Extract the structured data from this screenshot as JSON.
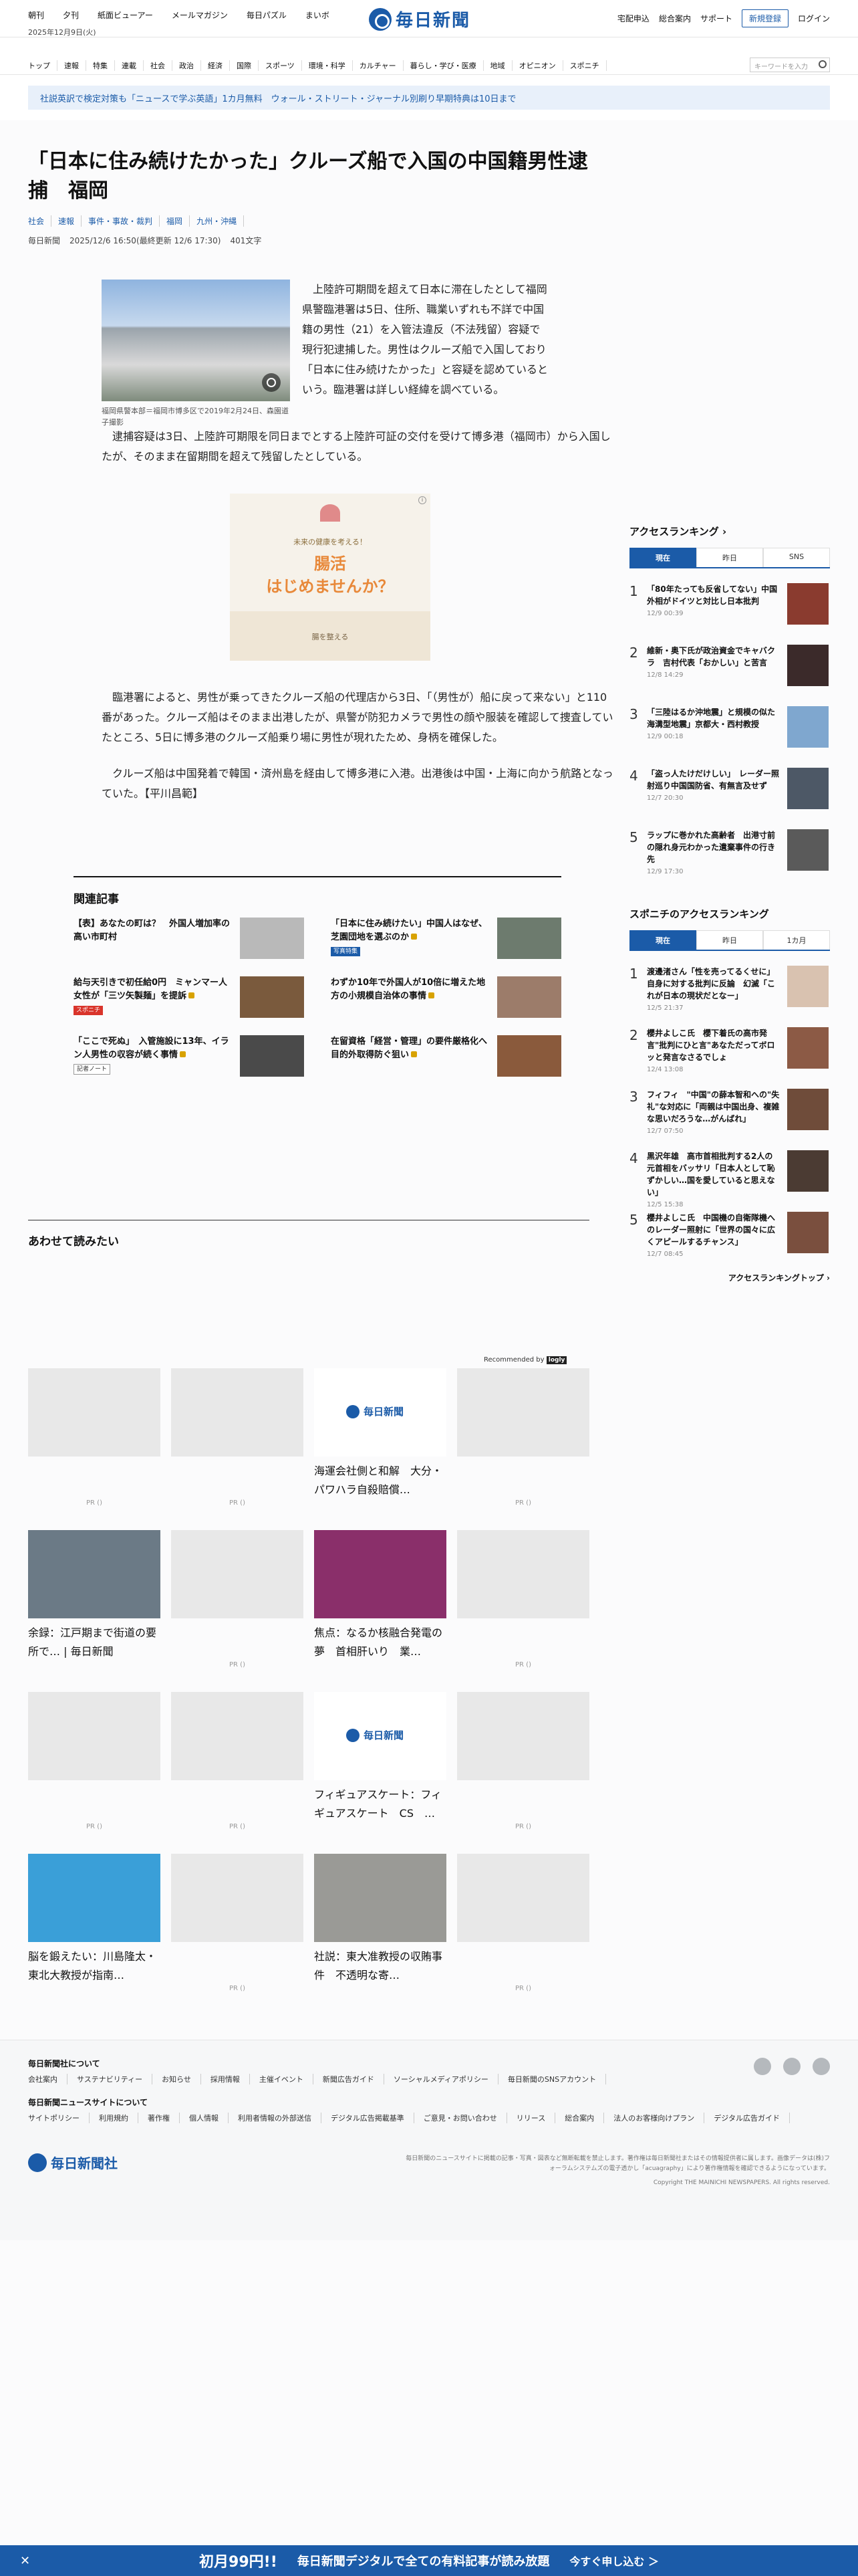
{
  "header": {
    "top_links": [
      "朝刊",
      "夕刊",
      "紙面ビューアー",
      "メールマガジン",
      "毎日パズル",
      "まいボ"
    ],
    "date": "2025年12月9日(火)",
    "logo_text": "毎日新聞",
    "right_links": [
      "宅配申込",
      "総合案内",
      "サポート"
    ],
    "register_label": "新規登録",
    "login_label": "ログイン"
  },
  "category_nav": {
    "items": [
      "トップ",
      "速報",
      "特集",
      "連載",
      "社会",
      "政治",
      "経済",
      "国際",
      "スポーツ",
      "環境・科学",
      "カルチャー",
      "暮らし・学び・医療",
      "地域",
      "オピニオン",
      "スポニチ"
    ],
    "search_placeholder": "キーワードを入力"
  },
  "promo": {
    "text": "社説英訳で検定対策も「ニュースで学ぶ英語」1カ月無料　ウォール・ストリート・ジャーナル別刷り早期特典は10日まで"
  },
  "article": {
    "title": "「日本に住み続けたかった」クルーズ船で入国の中国籍男性逮捕　福岡",
    "tags": [
      "社会",
      "速報",
      "事件・事故・裁判",
      "福岡",
      "九州・沖縄"
    ],
    "source": "毎日新聞",
    "datetime": "2025/12/6 16:50(最終更新 12/6 17:30)",
    "chars": "401文字",
    "photo_caption": "福岡県警本部＝福岡市博多区で2019年2月24日、森園道子撮影",
    "p1": "上陸許可期間を超えて日本に滞在したとして福岡県警臨港署は5日、住所、職業いずれも不詳で中国籍の男性（21）を入管法違反（不法残留）容疑で現行犯逮捕した。男性はクルーズ船で入国しており「日本に住み続けたかった」と容疑を認めているという。臨港署は詳しい経緯を調べている。",
    "p2": "逮捕容疑は3日、上陸許可期限を同日までとする上陸許可証の交付を受けて博多港（福岡市）から入国したが、そのまま在留期間を超えて残留したとしている。",
    "p3": "臨港署によると、男性が乗ってきたクルーズ船の代理店から3日、「（男性が）船に戻って来ない」と110番があった。クルーズ船はそのまま出港したが、県警が防犯カメラで男性の顔や服装を確認して捜査していたところ、5日に博多港のクルーズ船乗り場に男性が現れたため、身柄を確保した。",
    "p4": "クルーズ船は中国発着で韓国・済州島を経由して博多港に入港。出港後は中国・上海に向かう航路となっていた。【平川昌範】"
  },
  "ad": {
    "line1": "未来の健康を考える！",
    "main1": "腸活",
    "main2": "はじめませんか？",
    "foot": "腸を整える"
  },
  "related": {
    "title": "関連記事",
    "items": [
      {
        "text": "【表】あなたの町は？　外国人増加率の高い市町村",
        "badge": "",
        "locked": false,
        "color": "#b9b9b9"
      },
      {
        "text": "「日本に住み続けたい」中国人はなぜ、芝園団地を選ぶのか",
        "badge": "写真特集",
        "locked": true,
        "color": "#6d7b6e"
      },
      {
        "text": "給与天引きで初任給0円　ミャンマー人女性が「三ツ矢製麺」を提訴",
        "badge": "スポニチ",
        "locked": true,
        "color": "#7a5a3d"
      },
      {
        "text": "わずか10年で外国人が10倍に増えた地方の小規模自治体の事情",
        "badge": "",
        "locked": true,
        "color": "#9c7c6a"
      },
      {
        "text": "「ここで死ぬ」　入管施設に13年、イラン人男性の収容が続く事情",
        "badge": "記者ノート",
        "locked": true,
        "color": "#4a4a4a"
      },
      {
        "text": "在留資格「経営・管理」の要件厳格化へ　目的外取得防ぐ狙い",
        "badge": "",
        "locked": true,
        "color": "#8a5a3c"
      }
    ]
  },
  "read_more": {
    "title": "あわせて読みたい",
    "recommended_label": "Recommended by",
    "recommended_brand": "logly",
    "items": [
      {
        "title": "",
        "pr": "PR ()"
      },
      {
        "title": "",
        "pr": "PR ()"
      },
      {
        "title": "海運会社側と和解　大分・パワハラ自殺賠償…",
        "pr": ""
      },
      {
        "title": "",
        "pr": "PR ()"
      },
      {
        "title": "余録：江戸期まで街道の要所で… | 毎日新聞",
        "pr": ""
      },
      {
        "title": "",
        "pr": "PR ()"
      },
      {
        "title": "焦点：なるか核融合発電の夢　首相肝いり　業…",
        "pr": ""
      },
      {
        "title": "",
        "pr": "PR ()"
      },
      {
        "title": "",
        "pr": "PR ()"
      },
      {
        "title": "",
        "pr": "PR ()"
      },
      {
        "title": "フィギュアスケート：フィギュアスケート　CS　…",
        "pr": ""
      },
      {
        "title": "",
        "pr": "PR ()"
      },
      {
        "title": "脳を鍛えたい：川島隆太・東北大教授が指南…",
        "pr": ""
      },
      {
        "title": "",
        "pr": "PR ()"
      },
      {
        "title": "社説：東大准教授の収賄事件　不透明な寄…",
        "pr": ""
      },
      {
        "title": "",
        "pr": "PR ()"
      }
    ]
  },
  "sidebar": {
    "ranking_title": "アクセスランキング",
    "ranking_tabs": [
      "現在",
      "昨日",
      "SNS"
    ],
    "ranking": [
      {
        "num": "1",
        "text": "「80年たっても反省してない」中国外相がドイツと対比し日本批判",
        "time": "12/9 00:39",
        "color": "#8a3b2f"
      },
      {
        "num": "2",
        "text": "維新・奥下氏が政治資金でキャバクラ　吉村代表「おかしい」と苦言",
        "time": "12/8 14:29",
        "color": "#3b2a2a"
      },
      {
        "num": "3",
        "text": "「三陸はるか沖地震」と規模の似た海溝型地震」京都大・西村教授",
        "time": "12/9 00:18",
        "color": "#7fa7cf"
      },
      {
        "num": "4",
        "text": "「盗っ人たけだけしい」　レーダー照射巡り中国国防省、有無言及せず",
        "time": "12/7 20:30",
        "color": "#4d5866"
      },
      {
        "num": "5",
        "text": "ラップに巻かれた高齢者　出港寸前の隠れ身元わかった遺棄事件の行き先",
        "time": "12/9 17:30",
        "color": "#5a5a5a"
      }
    ],
    "sponichi_title": "スポニチのアクセスランキング",
    "sponichi_tabs": [
      "現在",
      "昨日",
      "1カ月"
    ],
    "sponichi": [
      {
        "num": "1",
        "text": "渡邊渚さん「性を売ってるくせに」自身に対する批判に反論　幻滅「これが日本の現状だとなー」",
        "time": "12/5 21:37",
        "color": "#d9c2b0"
      },
      {
        "num": "2",
        "text": "櫻井よしこ氏　櫻下着氏の高市発言\"批判にひと言\"あなただってボロッと発言なさるでしょ",
        "time": "12/4 13:08",
        "color": "#8c5a45"
      },
      {
        "num": "3",
        "text": "フィフィ　\"中国\"の薛本智和への\"失礼\"な対応に「両親は中国出身、複雑な思いだろうな…がんばれ」",
        "time": "12/7 07:50",
        "color": "#6f4c3a"
      },
      {
        "num": "4",
        "text": "黒沢年雄　高市首相批判する2人の元首相をバッサリ「日本人として恥ずかしい…国を愛していると思えない」",
        "time": "12/5 15:38",
        "color": "#4b3b33"
      },
      {
        "num": "5",
        "text": "櫻井よしこ氏　中国機の自衛隊機へのレーダー照射に「世界の国々に広くアピールするチャンス」",
        "time": "12/7 08:45",
        "color": "#7a4f3e"
      }
    ],
    "more_label": "アクセスランキングトップ"
  },
  "footer": {
    "about_title": "毎日新聞社について",
    "about_links": [
      "会社案内",
      "サステナビリティー",
      "お知らせ",
      "採用情報",
      "主催イベント",
      "新聞広告ガイド",
      "ソーシャルメディアポリシー",
      "毎日新聞のSNSアカウント"
    ],
    "site_title": "毎日新聞ニュースサイトについて",
    "site_links": [
      "サイトポリシー",
      "利用規約",
      "著作権",
      "個人情報",
      "利用者情報の外部送信",
      "デジタル広告掲載基準",
      "ご意見・お問い合わせ",
      "リリース",
      "総合案内",
      "法人のお客様向けプラン",
      "デジタル広告ガイド"
    ],
    "logo_text": "毎日新聞社",
    "note": "毎日新聞のニュースサイトに掲載の記事・写真・図表など無断転載を禁止します。著作権は毎日新聞社またはその情報提供者に属します。画像データは(株)フォーラムシステムズの電子透かし「acuagraphy」により著作権情報を確認できるようになっています。",
    "copyright": "Copyright THE MAINICHI NEWSPAPERS. All rights reserved."
  },
  "sticky": {
    "close": "✕",
    "price": "初月99円!!",
    "text": "毎日新聞デジタルで全ての有料記事が読み放題",
    "cta": "今すぐ申し込む ＞"
  }
}
